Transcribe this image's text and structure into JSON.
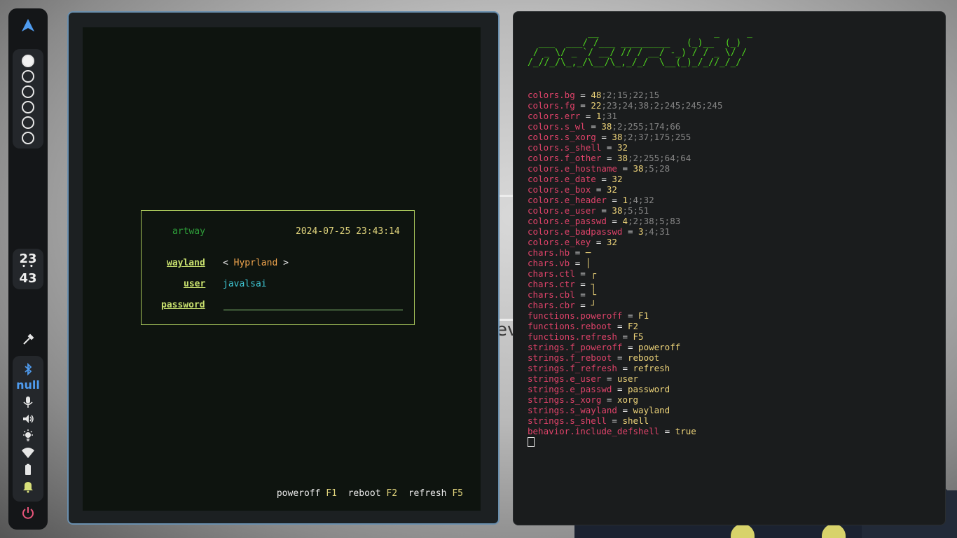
{
  "colors": {
    "accent_blue": "#4f9cf0",
    "config_key": "#e0436a",
    "config_value": "#eed47a",
    "ascii_green": "#4ed21e",
    "power_icon": "#e8557a"
  },
  "bar": {
    "logo_icon": "arch-logo-icon",
    "workspaces": [
      {
        "icon": "workspace-circle-icon",
        "active": true
      },
      {
        "icon": "workspace-circle-icon",
        "active": false
      },
      {
        "icon": "workspace-circle-icon",
        "active": false
      },
      {
        "icon": "workspace-circle-icon",
        "active": false
      },
      {
        "icon": "workspace-circle-icon",
        "active": false
      },
      {
        "icon": "workspace-circle-icon",
        "active": false
      }
    ],
    "clock": {
      "hour": "23",
      "minute": "43"
    },
    "bluetooth_label": "null",
    "icons": [
      "color-picker-icon",
      "bluetooth-icon",
      "microphone-icon",
      "volume-icon",
      "brightness-icon",
      "wifi-icon",
      "battery-icon",
      "notification-bell-icon",
      "power-icon"
    ]
  },
  "greeter": {
    "hostname": "artway",
    "datetime": "2024-07-25 23:43:14",
    "session_label": "wayland",
    "session_left": "< ",
    "session_name": "Hyprland",
    "session_right": " >",
    "user_label": "user",
    "user_value": "javalsai",
    "password_label": "password",
    "footer": {
      "poweroff": "poweroff",
      "poweroff_key": "F1",
      "reboot": "reboot",
      "reboot_key": "F2",
      "refresh": "refresh",
      "refresh_key": "F5"
    }
  },
  "background": {
    "text": "ev"
  },
  "config": {
    "ascii_art": [
      "           __                     _     _",
      "  ___  ___/ /___ _________   (_)__  (_)",
      " / _ \\/ _ `/ __/ // / __/ -_) / / _ \\/ /",
      "/_//_/\\_,_/\\__/\\_,_/_/  \\__(_)_/_//_/_/"
    ],
    "lines": [
      {
        "key": "colors.bg",
        "v1": "48",
        "v2": ";2;15;22;15"
      },
      {
        "key": "colors.fg",
        "v1": "22",
        "v2": ";23;24;38;2;245;245;245"
      },
      {
        "key": "colors.err",
        "v1": "1",
        "v2": ";31"
      },
      {
        "key": "colors.s_wl",
        "v1": "38",
        "v2": ";2;255;174;66"
      },
      {
        "key": "colors.s_xorg",
        "v1": "38",
        "v2": ";2;37;175;255"
      },
      {
        "key": "colors.s_shell",
        "v1": "32",
        "v2": ""
      },
      {
        "key": "colors.f_other",
        "v1": "38",
        "v2": ";2;255;64;64"
      },
      {
        "key": "colors.e_hostname",
        "v1": "38",
        "v2": ";5;28"
      },
      {
        "key": "colors.e_date",
        "v1": "32",
        "v2": ""
      },
      {
        "key": "colors.e_box",
        "v1": "32",
        "v2": ""
      },
      {
        "key": "colors.e_header",
        "v1": "1",
        "v2": ";4;32"
      },
      {
        "key": "colors.e_user",
        "v1": "38",
        "v2": ";5;51"
      },
      {
        "key": "colors.e_passwd",
        "v1": "4",
        "v2": ";2;38;5;83"
      },
      {
        "key": "colors.e_badpasswd",
        "v1": "3",
        "v2": ";4;31"
      },
      {
        "key": "colors.e_key",
        "v1": "32",
        "v2": ""
      },
      {
        "key": "chars.hb",
        "v1": "─",
        "v2": ""
      },
      {
        "key": "chars.vb",
        "v1": "│",
        "v2": ""
      },
      {
        "key": "chars.ctl",
        "v1": "┌",
        "v2": ""
      },
      {
        "key": "chars.ctr",
        "v1": "┐",
        "v2": ""
      },
      {
        "key": "chars.cbl",
        "v1": "└",
        "v2": ""
      },
      {
        "key": "chars.cbr",
        "v1": "┘",
        "v2": ""
      },
      {
        "key": "functions.poweroff",
        "v1": "F1",
        "v2": ""
      },
      {
        "key": "functions.reboot",
        "v1": "F2",
        "v2": ""
      },
      {
        "key": "functions.refresh",
        "v1": "F5",
        "v2": ""
      },
      {
        "key": "strings.f_poweroff",
        "v1": "poweroff",
        "v2": ""
      },
      {
        "key": "strings.f_reboot",
        "v1": "reboot",
        "v2": ""
      },
      {
        "key": "strings.f_refresh",
        "v1": "refresh",
        "v2": ""
      },
      {
        "key": "strings.e_user",
        "v1": "user",
        "v2": ""
      },
      {
        "key": "strings.e_passwd",
        "v1": "password",
        "v2": ""
      },
      {
        "key": "strings.s_xorg",
        "v1": "xorg",
        "v2": ""
      },
      {
        "key": "strings.s_wayland",
        "v1": "wayland",
        "v2": ""
      },
      {
        "key": "strings.s_shell",
        "v1": "shell",
        "v2": ""
      },
      {
        "key": "behavior.include_defshell",
        "v1": "true",
        "v2": ""
      }
    ]
  }
}
